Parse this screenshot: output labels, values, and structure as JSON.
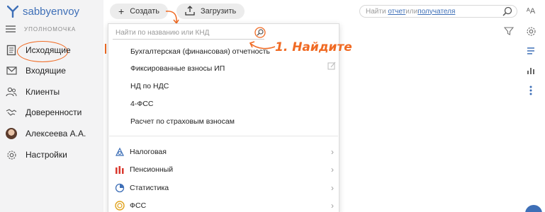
{
  "app": {
    "brand_sabby": "sabby",
    "brand_envoy": "envoy"
  },
  "sidebar": {
    "org_name": "УПОЛНОМОЧКА",
    "items": [
      {
        "label": "Исходящие",
        "icon": "document-list-icon",
        "active": true
      },
      {
        "label": "Входящие",
        "icon": "envelope-icon"
      },
      {
        "label": "Клиенты",
        "icon": "people-icon"
      },
      {
        "label": "Доверенности",
        "icon": "handshake-icon"
      },
      {
        "label": "Алексеева А.А.",
        "icon": "avatar"
      },
      {
        "label": "Настройки",
        "icon": "gear-icon"
      }
    ]
  },
  "toolbar": {
    "create_label": "Создать",
    "upload_label": "Загрузить",
    "search_prefix": "Найти ",
    "search_link1": "отчет",
    "search_middle": " или ",
    "search_link2": "получателя"
  },
  "dropdown": {
    "search_placeholder": "Найти по названию или КНД",
    "items": [
      "Бухгалтерская (финансовая) отчетность",
      "Фиксированные взносы ИП",
      "НД по НДС",
      "4-ФСС",
      "Расчет по страховым взносам"
    ],
    "categories": [
      {
        "label": "Налоговая",
        "icon": "tax-icon",
        "color": "#3e6fb7"
      },
      {
        "label": "Пенсионный",
        "icon": "pension-icon",
        "color": "#d9382e"
      },
      {
        "label": "Статистика",
        "icon": "statistics-icon",
        "color": "#3e6fb7"
      },
      {
        "label": "ФСС",
        "icon": "fss-icon",
        "color": "#e0a21c"
      }
    ]
  },
  "annotation": {
    "text": "1. Найдите"
  },
  "colors": {
    "accent": "#f06a23",
    "brand": "#3e6fb7"
  }
}
